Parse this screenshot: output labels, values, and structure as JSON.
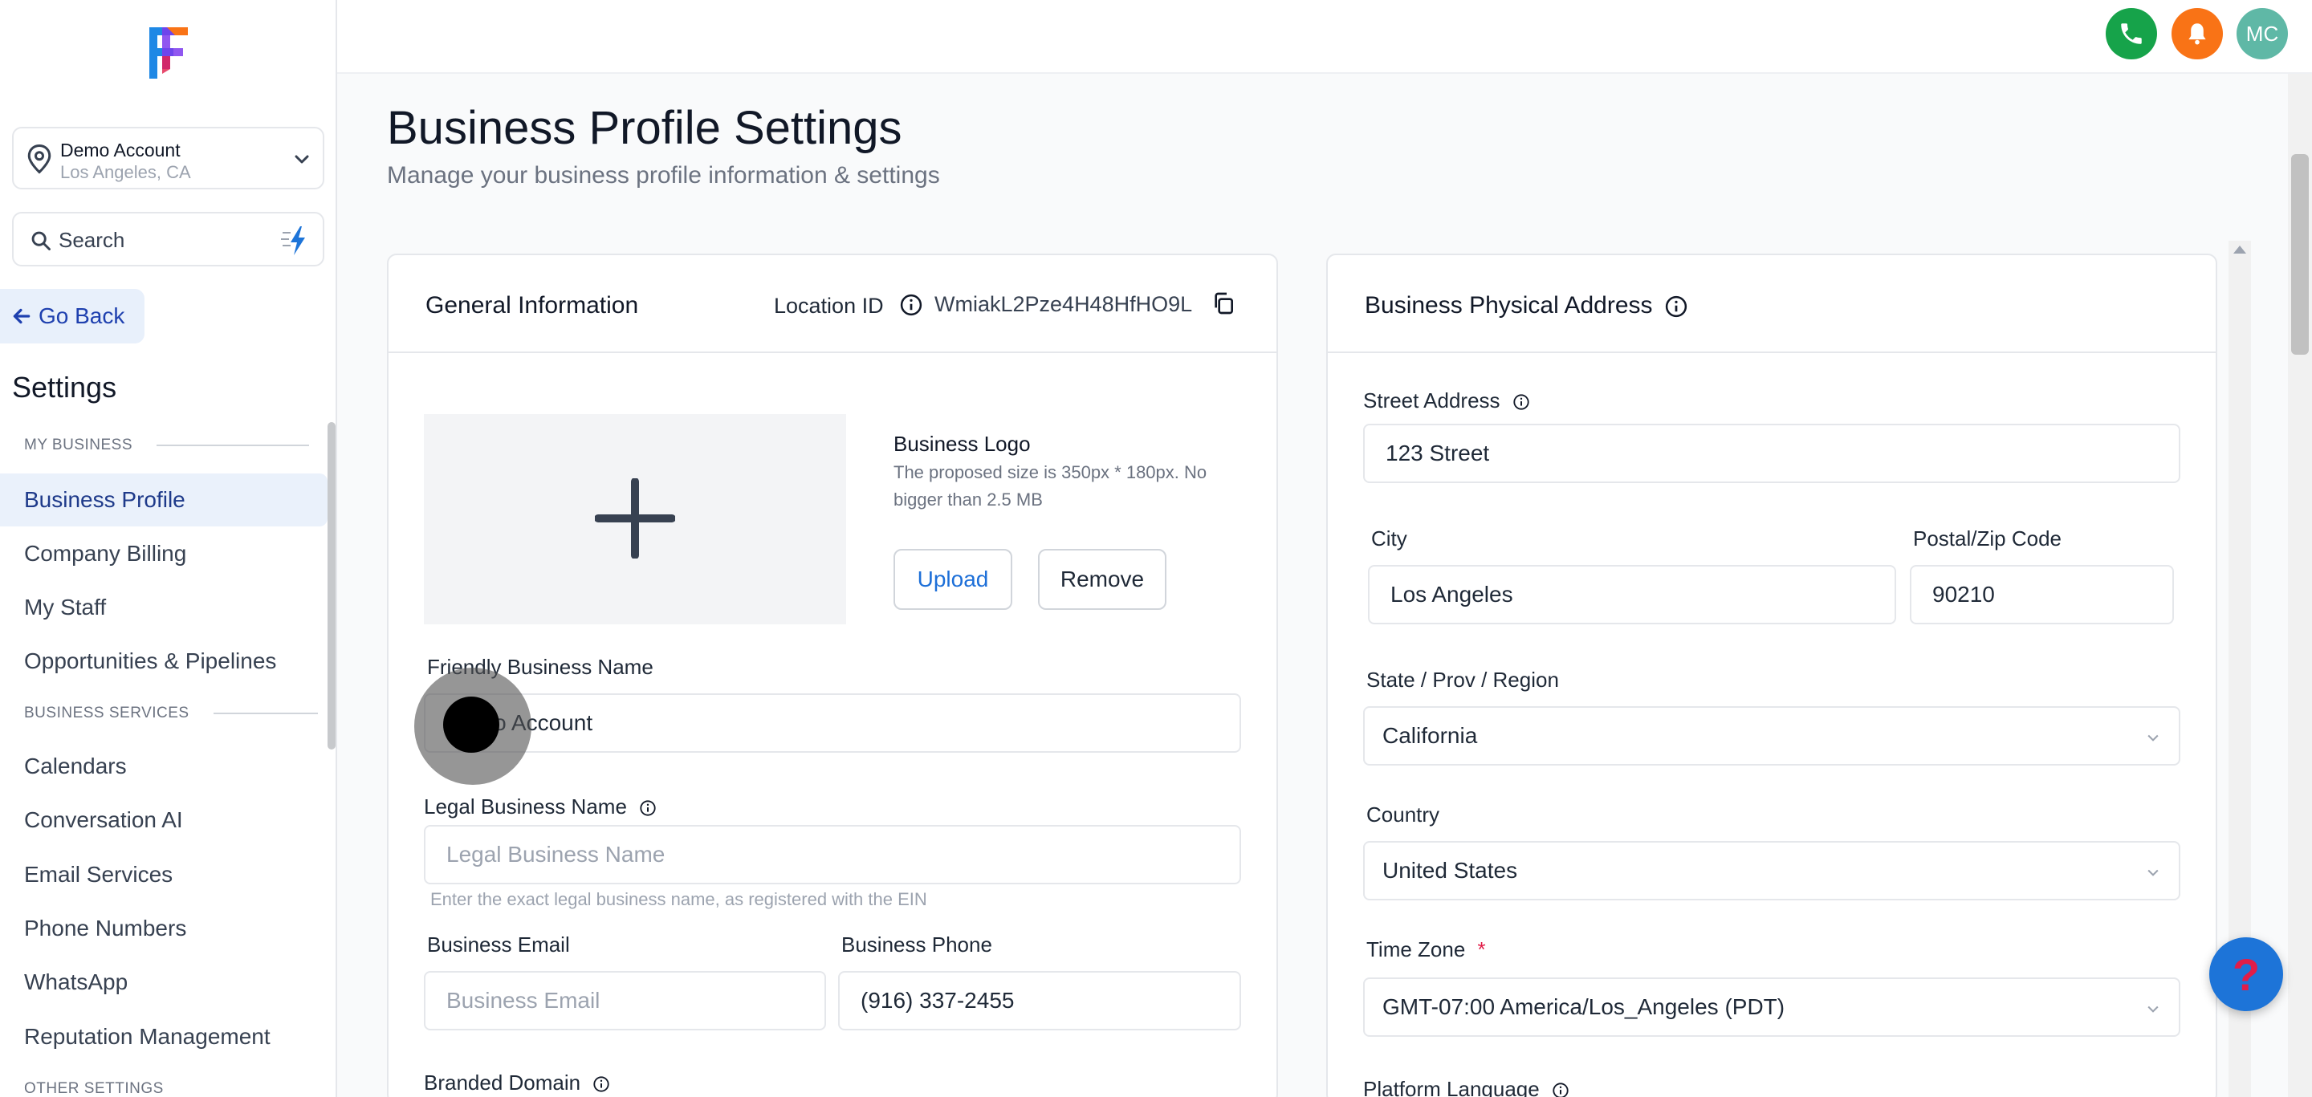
{
  "sidebar": {
    "account": {
      "name": "Demo Account",
      "location": "Los Angeles, CA"
    },
    "search": {
      "label": "Search"
    },
    "go_back": "Go Back",
    "settings_title": "Settings",
    "sections": [
      {
        "label": "MY BUSINESS"
      },
      {
        "label": "BUSINESS SERVICES"
      },
      {
        "label": "OTHER SETTINGS"
      }
    ],
    "items": [
      {
        "label": "Business Profile",
        "active": true
      },
      {
        "label": "Company Billing"
      },
      {
        "label": "My Staff"
      },
      {
        "label": "Opportunities & Pipelines"
      },
      {
        "label": "Calendars"
      },
      {
        "label": "Conversation AI"
      },
      {
        "label": "Email Services"
      },
      {
        "label": "Phone Numbers"
      },
      {
        "label": "WhatsApp"
      },
      {
        "label": "Reputation Management"
      }
    ]
  },
  "header": {
    "avatar_initials": "MC",
    "phone_color": "#16a34a",
    "bell_color": "#f97316",
    "avatar_color": "#5fb8a6"
  },
  "page": {
    "title": "Business Profile Settings",
    "subtitle": "Manage your business profile information & settings"
  },
  "general": {
    "title": "General Information",
    "location_id_label": "Location ID",
    "location_id_value": "WmiakL2Pze4H48HfHO9L",
    "logo_title": "Business Logo",
    "logo_help": "The proposed size is 350px * 180px. No bigger than 2.5 MB",
    "upload_label": "Upload",
    "remove_label": "Remove",
    "friendly_name_label": "Friendly Business Name",
    "friendly_name_value": "Demo Account",
    "legal_name_label": "Legal Business Name",
    "legal_name_placeholder": "Legal Business Name",
    "legal_name_help": "Enter the exact legal business name, as registered with the EIN",
    "email_label": "Business Email",
    "email_placeholder": "Business Email",
    "phone_label": "Business Phone",
    "phone_value": "(916) 337-2455",
    "branded_domain_label": "Branded Domain"
  },
  "address": {
    "title": "Business Physical Address",
    "street_label": "Street Address",
    "street_value": "123 Street",
    "city_label": "City",
    "city_value": "Los Angeles",
    "zip_label": "Postal/Zip Code",
    "zip_value": "90210",
    "state_label": "State / Prov / Region",
    "state_value": "California",
    "country_label": "Country",
    "country_value": "United States",
    "timezone_label": "Time Zone",
    "timezone_required": "*",
    "timezone_value": "GMT-07:00 America/Los_Angeles (PDT)",
    "language_label": "Platform Language"
  },
  "help_fab": "?"
}
